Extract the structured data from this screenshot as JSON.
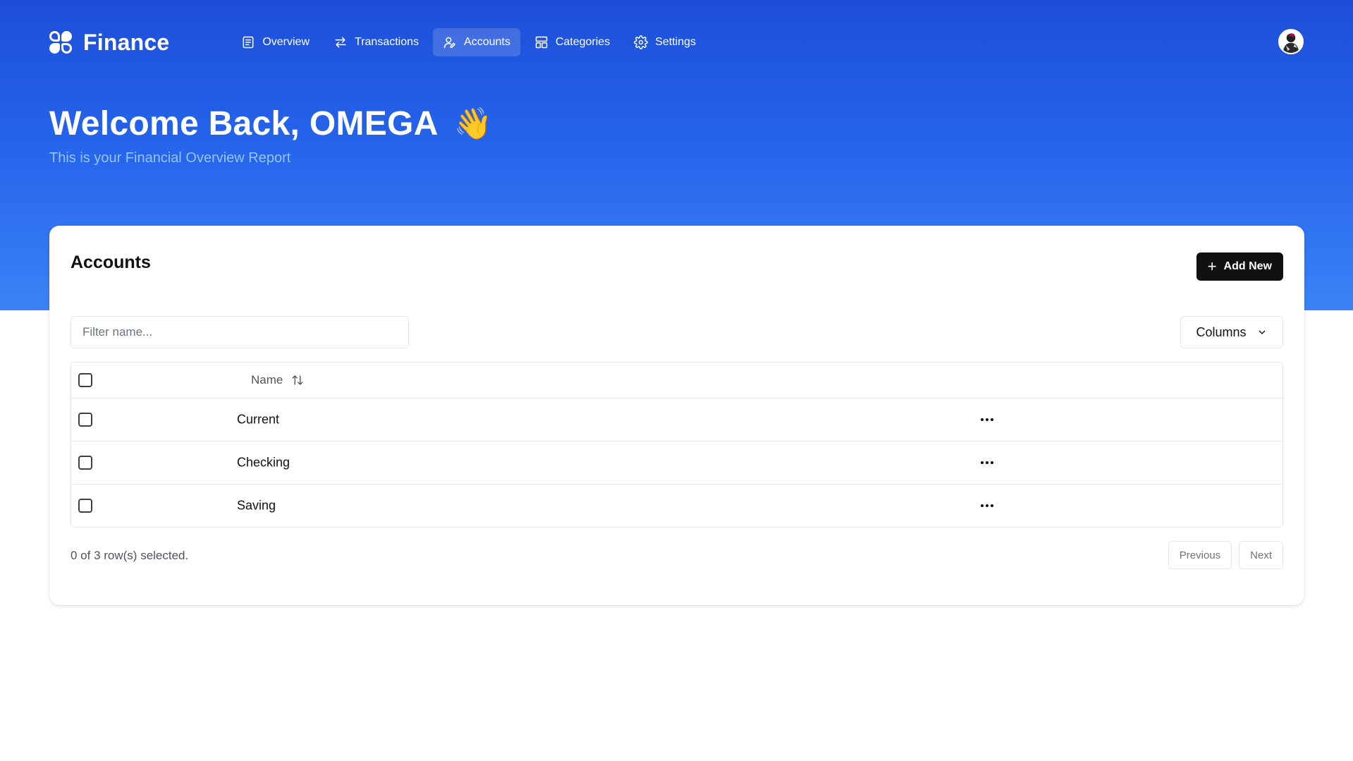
{
  "app": {
    "brand_name": "Finance",
    "brand_icon": "finance-logo-icon"
  },
  "nav": {
    "items": [
      {
        "label": "Overview",
        "icon": "document-list-icon",
        "active": false
      },
      {
        "label": "Transactions",
        "icon": "arrows-left-right-icon",
        "active": false
      },
      {
        "label": "Accounts",
        "icon": "user-edit-icon",
        "active": true
      },
      {
        "label": "Categories",
        "icon": "layout-grid-icon",
        "active": false
      },
      {
        "label": "Settings",
        "icon": "gear-icon",
        "active": false
      }
    ]
  },
  "user": {
    "avatar_icon": "user-avatar"
  },
  "hero": {
    "title": "Welcome Back, OMEGA",
    "emoji": "👋",
    "subtitle": "This is your Financial Overview Report"
  },
  "accounts_card": {
    "title": "Accounts",
    "add_button_label": "Add New",
    "filter_placeholder": "Filter name...",
    "filter_value": "",
    "columns_button_label": "Columns",
    "table": {
      "header": {
        "name": "Name"
      },
      "rows": [
        {
          "name": "Current",
          "selected": false
        },
        {
          "name": "Checking",
          "selected": false
        },
        {
          "name": "Saving",
          "selected": false
        }
      ]
    },
    "selected_count_text": "0 of 3 row(s) selected.",
    "pagination": {
      "previous_label": "Previous",
      "next_label": "Next"
    }
  },
  "colors": {
    "hero_gradient_top": "#1d4ed8",
    "hero_gradient_bottom": "#3b82f6",
    "subtitle": "#93c5fd",
    "primary_button": "#111111",
    "card_background": "#ffffff"
  }
}
